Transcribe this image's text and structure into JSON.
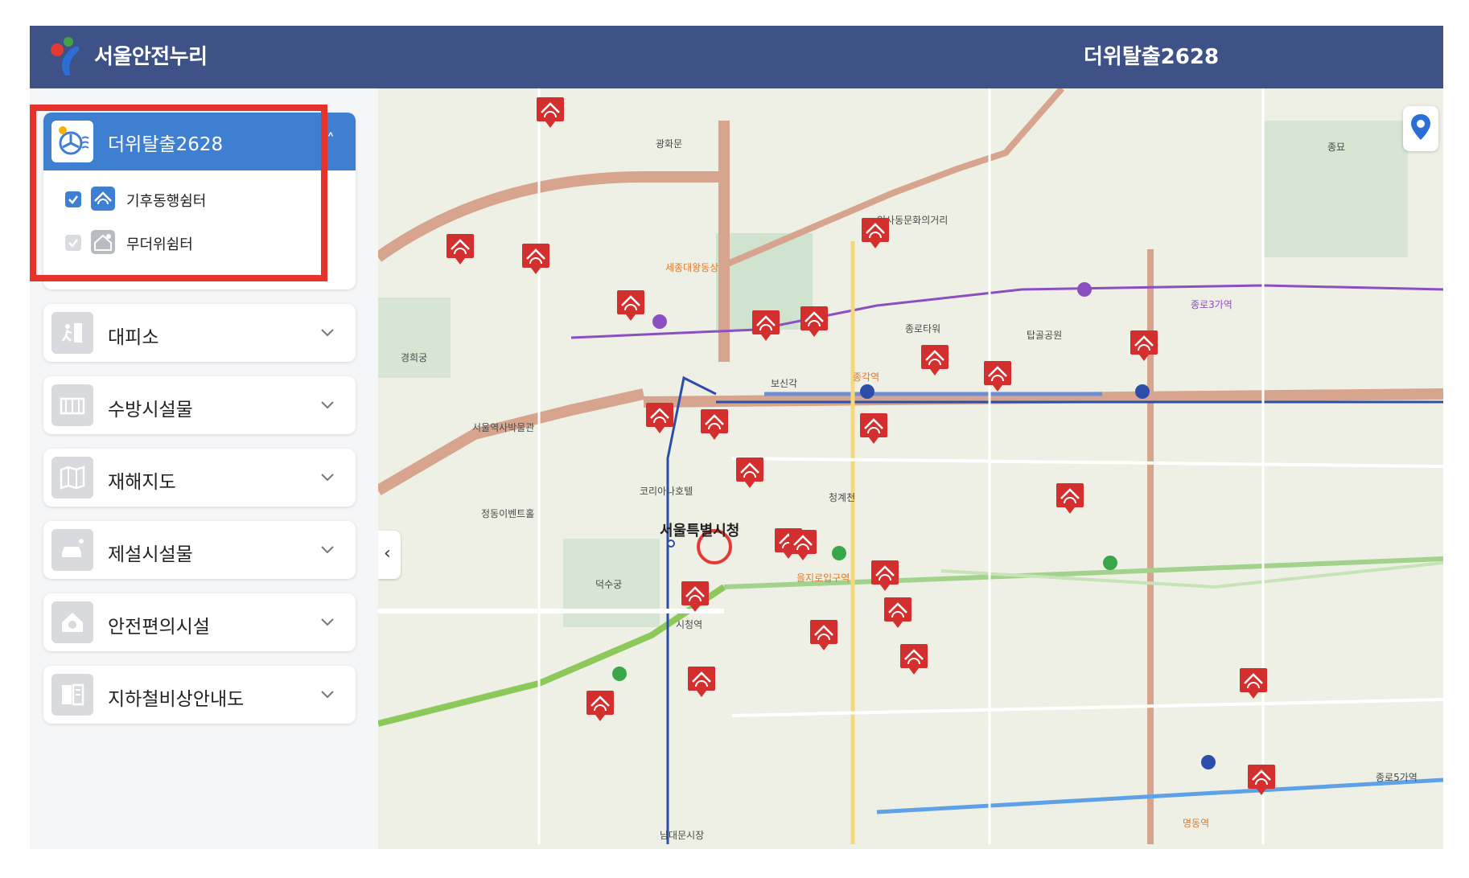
{
  "header": {
    "brand": "서울안전누리",
    "page_title": "더위탈출2628"
  },
  "sidebar": {
    "active_panel": {
      "label": "더위탈출2628",
      "sub_items": [
        {
          "label": "기후동행쉼터",
          "checked": true
        },
        {
          "label": "무더위쉼터",
          "checked": false
        }
      ]
    },
    "panels": [
      {
        "label": "대피소",
        "icon": "evacuation-icon"
      },
      {
        "label": "수방시설물",
        "icon": "flood-facility-icon"
      },
      {
        "label": "재해지도",
        "icon": "disaster-map-icon"
      },
      {
        "label": "제설시설물",
        "icon": "snow-removal-icon"
      },
      {
        "label": "안전편의시설",
        "icon": "safety-home-icon"
      },
      {
        "label": "지하철비상안내도",
        "icon": "subway-guide-icon"
      }
    ]
  },
  "map": {
    "labels": {
      "city_hall": "서울특별시청",
      "jonggak": "종각역",
      "city_hall_station": "시청역",
      "gwanghwamun": "광화문",
      "insadong": "인사동문화의거리",
      "cheonggyecheon": "청계천",
      "deoksugung": "덕수궁",
      "gyeonghuigung": "경희궁",
      "jongno3": "종로3가역",
      "euljiro": "을지로입구역",
      "jongmyo": "종묘",
      "myeongdong": "명동역",
      "tapgol": "탑골공원",
      "jongno_tower": "종로타워",
      "koreana": "코리아나호텔",
      "sejong": "세종대왕동상",
      "bosingak": "보신각",
      "jeongdong": "정동이벤트홀",
      "seoul_museum": "서울역사박물관",
      "dongdaemun": "종로5가역",
      "namdaemun": "남대문시장"
    },
    "colors": {
      "header": "#3f5287",
      "active": "#3f7fd1",
      "shelter_marker": "#d32f2f",
      "highlight": "#e5322b",
      "line1": "#2d4ea8",
      "line2": "#3aa64a",
      "line5": "#8a4fc1"
    }
  }
}
